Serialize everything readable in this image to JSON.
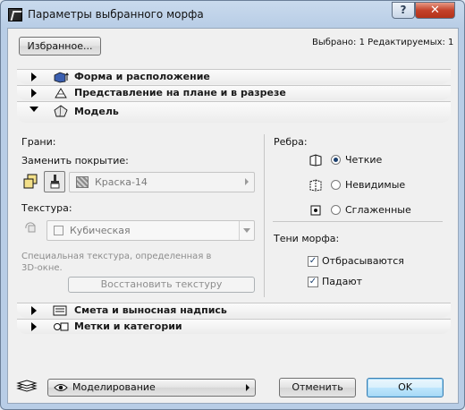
{
  "window": {
    "title": "Параметры выбранного морфа",
    "help_label": "?",
    "close_label": "✕"
  },
  "header": {
    "favorites_label": "Избранное...",
    "selection_info": "Выбрано: 1 Редактируемых: 1"
  },
  "sections": {
    "shape": "Форма и расположение",
    "plan": "Представление на плане и в разрезе",
    "model": "Модель",
    "listing": "Смета и выносная надпись",
    "tags": "Метки и категории"
  },
  "model": {
    "faces_label": "Грани:",
    "override_label": "Заменить покрытие:",
    "surface_value": "Краска-14",
    "texture_label": "Текстура:",
    "texture_value": "Кубическая",
    "texture_note": "Специальная текстура, определенная в 3D-окне.",
    "restore_texture_label": "Восстановить текстуру",
    "edges_label": "Ребра:",
    "edges_options": [
      "Четкие",
      "Невидимые",
      "Сглаженные"
    ],
    "edges_selected": "Четкие",
    "shadows_label": "Тени морфа:",
    "cast_label": "Отбрасываются",
    "cast_checked": true,
    "receive_label": "Падают",
    "receive_checked": true
  },
  "footer": {
    "layer_value": "Моделирование",
    "cancel_label": "Отменить",
    "ok_label": "OK"
  },
  "colors": {
    "accent": "#1a3f6e",
    "frame": "#b8cde6",
    "close_button": "#c4422a"
  }
}
